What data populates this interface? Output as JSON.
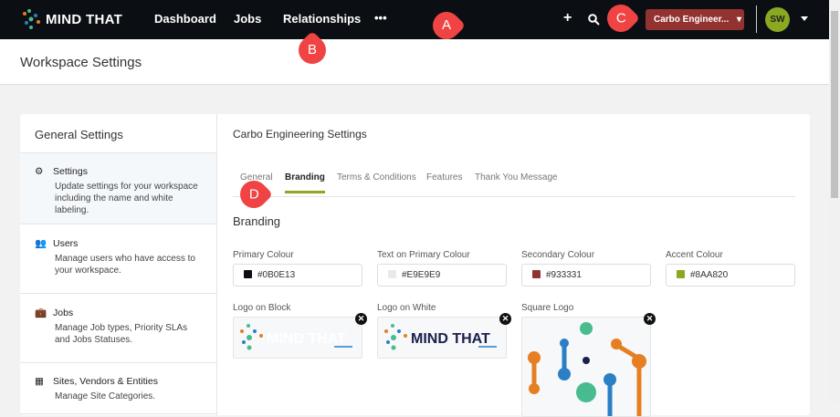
{
  "nav": {
    "brand": "MIND THAT",
    "links": [
      "Dashboard",
      "Jobs",
      "Relationships"
    ],
    "more": "•••",
    "add_icon": "plus-icon",
    "search_icon": "search-icon",
    "workspace": "Carbo Engineer...",
    "avatar": "SW"
  },
  "page_title": "Workspace Settings",
  "sidebar": {
    "title": "General Settings",
    "items": [
      {
        "label": "Settings",
        "desc": "Update settings for your workspace including the name and white labeling.",
        "icon": "gear-icon"
      },
      {
        "label": "Users",
        "desc": "Manage users who have access to your workspace.",
        "icon": "users-icon"
      },
      {
        "label": "Jobs",
        "desc": "Manage Job types, Priority SLAs and Jobs Statuses.",
        "icon": "briefcase-icon"
      },
      {
        "label": "Sites, Vendors & Entities",
        "desc": "Manage Site Categories.",
        "icon": "building-icon"
      }
    ]
  },
  "main": {
    "title": "Carbo Engineering Settings",
    "tabs": [
      "General",
      "Branding",
      "Terms & Conditions",
      "Features",
      "Thank You Message"
    ],
    "active_tab": "Branding",
    "section": "Branding",
    "colours": [
      {
        "label": "Primary Colour",
        "value": "#0B0E13"
      },
      {
        "label": "Text on Primary Colour",
        "value": "#E9E9E9"
      },
      {
        "label": "Secondary Colour",
        "value": "#933331"
      },
      {
        "label": "Accent Colour",
        "value": "#8AA820"
      }
    ],
    "logos": [
      "Logo on Block",
      "Logo on White",
      "Square Logo"
    ]
  },
  "annotations": [
    "A",
    "B",
    "C",
    "D"
  ]
}
